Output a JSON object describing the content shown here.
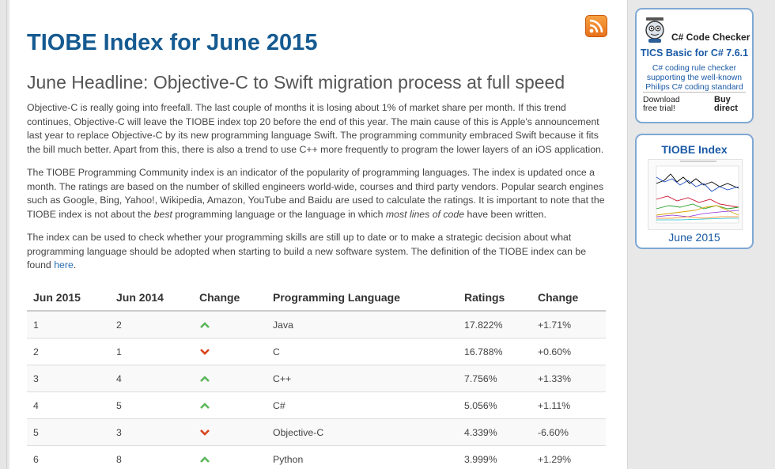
{
  "header": {
    "title": "TIOBE Index for June 2015",
    "headline": "June Headline: Objective-C to Swift migration process at full speed"
  },
  "paragraphs": {
    "p1": "Objective-C is really going into freefall. The last couple of months it is losing about 1% of market share per month. If this trend continues, Objective-C will leave the TIOBE index top 20 before the end of this year. The main cause of this is Apple's announcement last year to replace Objective-C by its new programming language Swift. The programming community embraced Swift because it fits the bill much better. Apart from this, there is also a trend to use C++ more frequently to program the lower layers of an iOS application.",
    "p2_a": "The TIOBE Programming Community index is an indicator of the popularity of programming languages. The index is updated once a month. The ratings are based on the number of skilled engineers world-wide, courses and third party vendors. Popular search engines such as Google, Bing, Yahoo!, Wikipedia, Amazon, YouTube and Baidu are used to calculate the ratings. It is important to note that the TIOBE index is not about the ",
    "p2_best": "best",
    "p2_b": " programming language or the language in which ",
    "p2_most": "most lines of code",
    "p2_c": " have been written.",
    "p3_a": "The index can be used to check whether your programming skills are still up to date or to make a strategic decision about what programming language should be adopted when starting to build a new software system. The definition of the TIOBE index can be found ",
    "p3_link": "here",
    "p3_b": "."
  },
  "table": {
    "headers": [
      "Jun 2015",
      "Jun 2014",
      "Change",
      "Programming Language",
      "Ratings",
      "Change"
    ],
    "rows": [
      {
        "rank": "1",
        "prev": "2",
        "dir": "up",
        "lang": "Java",
        "rating": "17.822%",
        "change": "+1.71%"
      },
      {
        "rank": "2",
        "prev": "1",
        "dir": "down",
        "lang": "C",
        "rating": "16.788%",
        "change": "+0.60%"
      },
      {
        "rank": "3",
        "prev": "4",
        "dir": "up",
        "lang": "C++",
        "rating": "7.756%",
        "change": "+1.33%"
      },
      {
        "rank": "4",
        "prev": "5",
        "dir": "up",
        "lang": "C#",
        "rating": "5.056%",
        "change": "+1.11%"
      },
      {
        "rank": "5",
        "prev": "3",
        "dir": "down",
        "lang": "Objective-C",
        "rating": "4.339%",
        "change": "-6.60%"
      },
      {
        "rank": "6",
        "prev": "8",
        "dir": "up",
        "lang": "Python",
        "rating": "3.999%",
        "change": "+1.29%"
      }
    ]
  },
  "sidebar": {
    "checker": {
      "title": "C# Code Checker",
      "product": "TICS Basic for C# 7.6.1",
      "desc": [
        "C# coding rule checker",
        "supporting the well-known",
        "Philips C# coding standard"
      ],
      "download": [
        "Download",
        "free trial!"
      ],
      "buy": [
        "Buy",
        "direct"
      ]
    },
    "index_box": {
      "title": "TIOBE Index",
      "date": "June 2015"
    }
  },
  "icons": {
    "rss": "rss-feed-icon",
    "up": "arrow-up-icon",
    "down": "arrow-down-icon"
  },
  "colors": {
    "title": "#155a91",
    "up": "#5cb85c",
    "down": "#d9441c",
    "sidebar_border": "#7fa8d4"
  }
}
